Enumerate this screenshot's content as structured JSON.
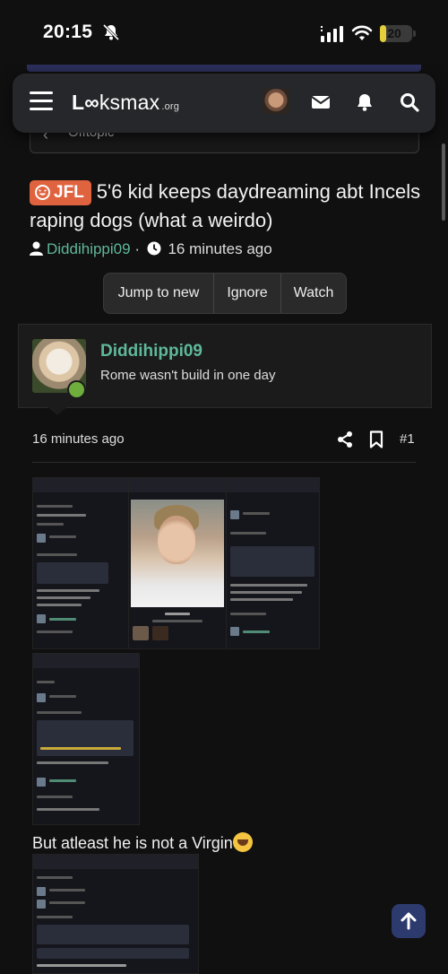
{
  "status_bar": {
    "time": "20:15",
    "battery": "20",
    "battery_level": 0.2,
    "battery_color": "#e4cf3b"
  },
  "breadcrumb": {
    "label": "Offtopic"
  },
  "navbar": {
    "logo_main": "L",
    "logo_o": "∞",
    "logo_rest": "ksmax",
    "logo_tld": ".org",
    "icons": [
      "menu-icon",
      "envelope-icon",
      "bell-icon",
      "search-icon"
    ]
  },
  "thread": {
    "prefix": "JFL",
    "prefix_color": "#e0633f",
    "title": "5'6 kid keeps daydreaming abt Incels raping dogs (what a weirdo)",
    "author": "Diddihippi09",
    "separator": "·",
    "time": "16 minutes ago",
    "actions": [
      "Jump to new",
      "Ignore",
      "Watch"
    ]
  },
  "post": {
    "username": "Diddihippi09",
    "user_title": "Rome wasn't build in one day",
    "time": "16 minutes ago",
    "number": "#1",
    "accent_color": "#5fb89a",
    "caption": "But atleast he is not a Virgin"
  }
}
